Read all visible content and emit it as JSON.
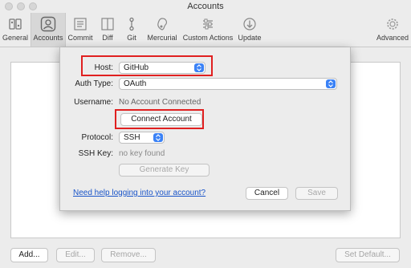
{
  "window": {
    "title": "Accounts"
  },
  "toolbar": {
    "items": [
      {
        "label": "General",
        "icon": "phone-switch-icon"
      },
      {
        "label": "Accounts",
        "icon": "account-icon"
      },
      {
        "label": "Commit",
        "icon": "commit-icon"
      },
      {
        "label": "Diff",
        "icon": "diff-icon"
      },
      {
        "label": "Git",
        "icon": "git-icon"
      },
      {
        "label": "Mercurial",
        "icon": "mercurial-icon"
      },
      {
        "label": "Custom Actions",
        "icon": "custom-actions-icon"
      },
      {
        "label": "Update",
        "icon": "update-icon"
      },
      {
        "label": "Advanced",
        "icon": "gear-icon"
      }
    ],
    "active": "Accounts"
  },
  "sheet": {
    "host_label": "Host:",
    "host_value": "GitHub",
    "auth_label": "Auth Type:",
    "auth_value": "OAuth",
    "username_label": "Username:",
    "username_value": "No Account Connected",
    "connect_button": "Connect Account",
    "protocol_label": "Protocol:",
    "protocol_value": "SSH",
    "sshkey_label": "SSH Key:",
    "sshkey_value": "no key found",
    "generate_button": "Generate Key",
    "help_link": "Need help logging into your account?",
    "cancel_button": "Cancel",
    "save_button": "Save"
  },
  "bottom": {
    "add": "Add...",
    "edit": "Edit...",
    "remove": "Remove...",
    "set_default": "Set Default..."
  },
  "colors": {
    "highlight": "#e02020",
    "accent": "#3b82f6",
    "link": "#1a55c9"
  }
}
